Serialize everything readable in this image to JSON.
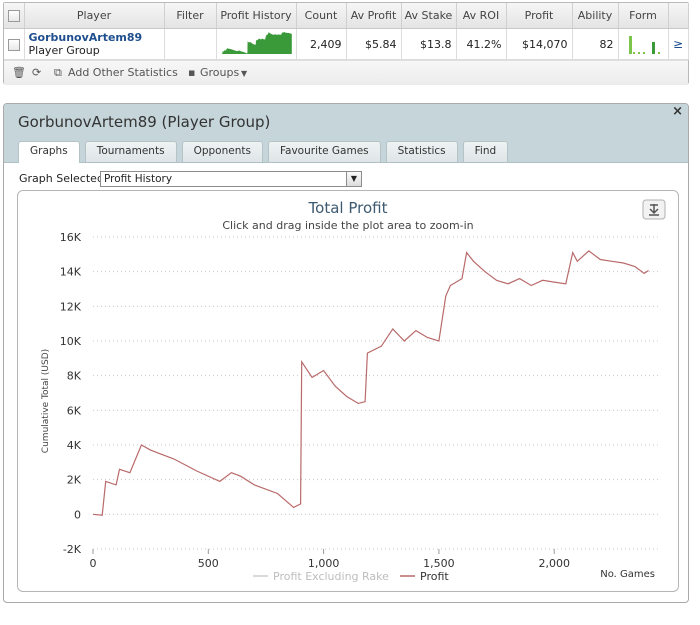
{
  "stats_table": {
    "headers": [
      "Player",
      "Filter",
      "Profit History",
      "Count",
      "Av Profit",
      "Av Stake",
      "Av ROI",
      "Profit",
      "Ability",
      "Form"
    ],
    "row": {
      "player_name": "GorbunovArtem89",
      "player_type": "Player Group",
      "count": "2,409",
      "av_profit": "$5.84",
      "av_stake": "$13.8",
      "av_roi": "41.2%",
      "profit": "$14,070",
      "ability": "82"
    },
    "sparkline_color": "#3a9a3a",
    "form_bar_color": "#7cc44a",
    "toolbar": {
      "add_other_stats": "Add Other Statistics",
      "groups": "Groups"
    }
  },
  "dialog": {
    "title": "GorbunovArtem89 (Player Group)",
    "tabs": [
      "Graphs",
      "Tournaments",
      "Opponents",
      "Favourite Games",
      "Statistics",
      "Find"
    ],
    "active_tab": "Graphs",
    "graph_selected_label": "Graph Selected:",
    "graph_selected_value": "Profit History"
  },
  "chart_data": {
    "type": "line",
    "title": "Total Profit",
    "subtitle": "Click and drag inside the plot area to zoom-in",
    "ylabel": "Cumulative Total (USD)",
    "xlabel": "No. Games",
    "ylim": [
      -2000,
      16000
    ],
    "xlim": [
      0,
      2450
    ],
    "yticks": [
      "-2K",
      "0",
      "2K",
      "4K",
      "6K",
      "8K",
      "10K",
      "12K",
      "14K",
      "16K"
    ],
    "xticks": [
      "0",
      "500",
      "1,000",
      "1,500",
      "2,000"
    ],
    "grid": true,
    "legend_position": "bottom-center",
    "series": [
      {
        "name": "Profit Excluding Rake",
        "color": "#cccccc",
        "x": [],
        "y": []
      },
      {
        "name": "Profit",
        "color": "#b96a6a",
        "x": [
          0,
          40,
          55,
          100,
          115,
          160,
          210,
          250,
          350,
          450,
          550,
          600,
          640,
          700,
          800,
          870,
          900,
          905,
          950,
          1000,
          1050,
          1100,
          1150,
          1180,
          1190,
          1250,
          1300,
          1350,
          1400,
          1450,
          1500,
          1530,
          1550,
          1600,
          1620,
          1650,
          1700,
          1750,
          1800,
          1850,
          1900,
          1950,
          2000,
          2050,
          2080,
          2100,
          2150,
          2200,
          2250,
          2300,
          2350,
          2390,
          2409
        ],
        "y": [
          0,
          -50,
          1900,
          1700,
          2600,
          2400,
          4000,
          3700,
          3200,
          2500,
          1900,
          2400,
          2200,
          1700,
          1200,
          400,
          600,
          8800,
          7900,
          8300,
          7400,
          6800,
          6400,
          6500,
          9300,
          9700,
          10700,
          10000,
          10600,
          10200,
          10000,
          12600,
          13200,
          13600,
          15100,
          14600,
          14000,
          13500,
          13300,
          13600,
          13200,
          13500,
          13400,
          13300,
          15100,
          14600,
          15200,
          14700,
          14600,
          14500,
          14300,
          13900,
          14070
        ]
      }
    ]
  }
}
